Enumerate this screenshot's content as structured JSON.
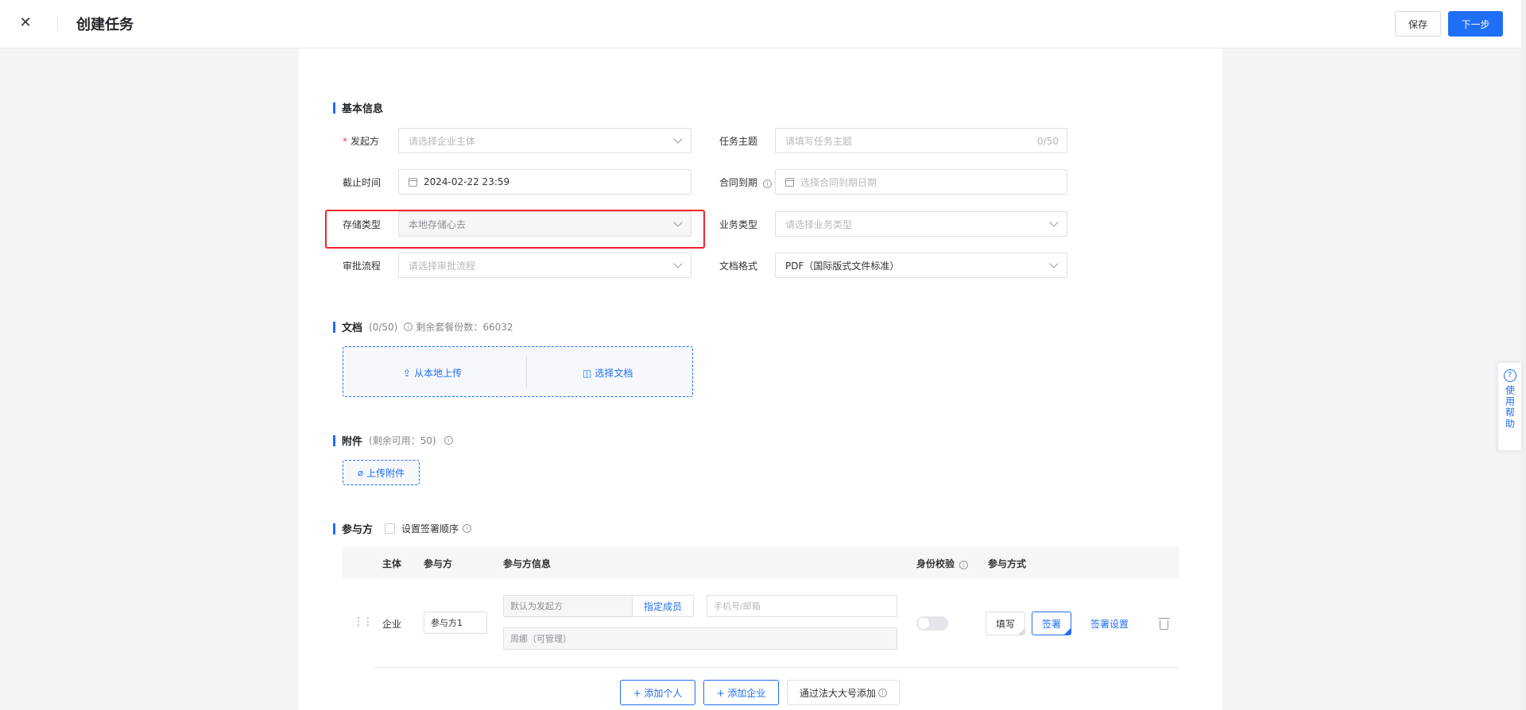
{
  "header": {
    "close_glyph": "✕",
    "title": "创建任务",
    "save_label": "保存",
    "next_label": "下一步"
  },
  "basic_info": {
    "title": "基本信息",
    "initiator": {
      "label": "发起方",
      "required_mark": "*",
      "placeholder": "请选择企业主体"
    },
    "task_subject": {
      "label": "任务主题",
      "placeholder": "请填写任务主题",
      "counter": "0/50"
    },
    "deadline": {
      "label": "截止时间",
      "value": "2024-02-22 23:59"
    },
    "contract_expiry": {
      "label": "合同到期",
      "placeholder": "选择合同到期日期"
    },
    "storage_type": {
      "label": "存储类型",
      "value": "本地存储心去"
    },
    "business_type": {
      "label": "业务类型",
      "placeholder": "请选择业务类型"
    },
    "approval_flow": {
      "label": "审批流程",
      "placeholder": "请选择审批流程"
    },
    "doc_format": {
      "label": "文档格式",
      "value": "PDF（国际版式文件标准）"
    }
  },
  "documents": {
    "title": "文档",
    "count": "(0/50)",
    "remaining": "剩余套餐份数：66032",
    "upload_local": "从本地上传",
    "choose_doc": "选择文档"
  },
  "attachments": {
    "title": "附件",
    "remaining": "(剩余可用：50)",
    "upload_label": "上传附件"
  },
  "participants": {
    "title": "参与方",
    "order_checkbox_label": "设置签署顺序",
    "columns": {
      "subject": "主体",
      "party": "参与方",
      "party_info": "参与方信息",
      "id_check": "身份校验",
      "mode": "参与方式"
    },
    "row": {
      "subject": "企业",
      "party_name": "参与方1",
      "default_initiator": "默认为发起方",
      "assign_member": "指定成员",
      "contact_placeholder": "手机号/邮箱",
      "manager": "周娜（可管理）",
      "mode_fill": "填写",
      "mode_sign": "签署",
      "sign_settings": "签署设置"
    },
    "add_person": "+ 添加个人",
    "add_company": "+ 添加企业",
    "add_via_fadada": "通过法大大号添加"
  },
  "help": {
    "label": "使用帮助",
    "glyph": "?"
  }
}
